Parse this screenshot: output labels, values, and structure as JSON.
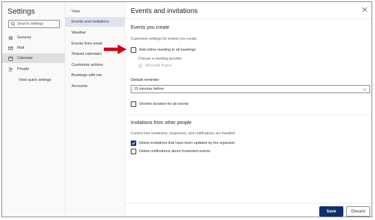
{
  "settings": {
    "title": "Settings",
    "search_placeholder": "Search settings",
    "nav": [
      {
        "label": "General",
        "icon": "gear-icon"
      },
      {
        "label": "Mail",
        "icon": "mail-icon"
      },
      {
        "label": "Calendar",
        "icon": "calendar-icon",
        "selected": true
      },
      {
        "label": "People",
        "icon": "people-icon"
      },
      {
        "label": "View quick settings"
      }
    ]
  },
  "calendar_menu": [
    {
      "label": "View"
    },
    {
      "label": "Events and invitations",
      "selected": true
    },
    {
      "label": "Weather"
    },
    {
      "label": "Events from email"
    },
    {
      "label": "Shared calendars"
    },
    {
      "label": "Customize actions"
    },
    {
      "label": "Bookings with me"
    },
    {
      "label": "Accounts"
    }
  ],
  "pane": {
    "title": "Events and invitations",
    "events_you_create": {
      "heading": "Events you create",
      "description": "Customize settings for events you create.",
      "online_meeting_label": "Add online meeting to all meetings",
      "online_meeting_checked": false,
      "provider_label": "Choose a meeting provider",
      "provider_option": "Microsoft Teams",
      "default_reminder_label": "Default reminder",
      "default_reminder_value": "15 minutes before",
      "shorten_label": "Shorten duration for all events",
      "shorten_checked": false
    },
    "invitations": {
      "heading": "Invitations from other people",
      "description": "Control how invitations, responses, and notifications are handled.",
      "delete_updated_label": "Delete invitations that have been updated by the organizer",
      "delete_updated_checked": true,
      "delete_forwarded_label": "Delete notifications about forwarded events",
      "delete_forwarded_checked": false
    },
    "buttons": {
      "save": "Save",
      "discard": "Discard"
    }
  },
  "colors": {
    "accent": "#0f2e6e",
    "selected_nav": "#dfe3f0",
    "arrow": "#d0021b"
  }
}
